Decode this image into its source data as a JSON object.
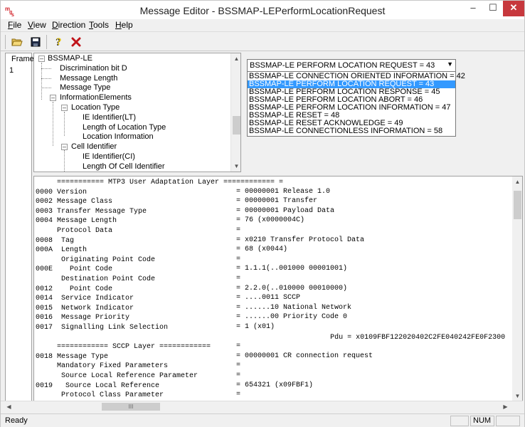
{
  "window": {
    "title": "Message Editor - BSSMAP-LEPerformLocationRequest",
    "app_icon": "msg-logo-icon",
    "minimize_icon": "minimize-icon",
    "maximize_icon": "maximize-icon",
    "close_icon": "close-icon",
    "min_glyph": "–",
    "max_glyph": "☐",
    "close_glyph": "✕"
  },
  "menu": {
    "items": [
      {
        "first": "F",
        "rest": "ile"
      },
      {
        "first": "V",
        "rest": "iew"
      },
      {
        "first": "D",
        "rest": "irection"
      },
      {
        "first": "T",
        "rest": "ools"
      },
      {
        "first": "H",
        "rest": "elp"
      }
    ]
  },
  "toolbar": {
    "buttons": [
      "open-folder-icon",
      "save-disk-icon",
      "help-question-icon",
      "close-x-icon"
    ]
  },
  "frames": {
    "header": "Frame",
    "items": [
      "1"
    ]
  },
  "tree": {
    "nodes": [
      {
        "label": "BSSMAP-LE",
        "toggle": "–"
      },
      {
        "label": "Discrimination bit D"
      },
      {
        "label": "Message Length"
      },
      {
        "label": "Message Type"
      },
      {
        "label": "InformationElements",
        "toggle": "–"
      },
      {
        "label": "Location Type",
        "toggle": "–"
      },
      {
        "label": "IE Identifier(LT)"
      },
      {
        "label": "Length of Location Type"
      },
      {
        "label": "Location Information"
      },
      {
        "label": "Cell Identifier",
        "toggle": "–"
      },
      {
        "label": "IE Identifier(CI)"
      },
      {
        "label": "Length Of Cell Identifier"
      }
    ]
  },
  "combo": {
    "selected": "BSSMAP-LE PERFORM LOCATION REQUEST = 43",
    "options": [
      "BSSMAP-LE CONNECTION ORIENTED INFORMATION = 42",
      "BSSMAP-LE PERFORM LOCATION REQUEST = 43",
      "BSSMAP-LE PERFORM LOCATION RESPONSE = 45",
      "BSSMAP-LE PERFORM LOCATION ABORT = 46",
      "BSSMAP-LE PERFORM LOCATION INFORMATION = 47",
      "BSSMAP-LE RESET = 48",
      "BSSMAP-LE RESET ACKNOWLEDGE = 49",
      "BSSMAP-LE CONNECTIONLESS INFORMATION = 58"
    ],
    "highlighted_index": 1
  },
  "decode": {
    "lines": [
      {
        "field": "     =========== MTP3 User Adaptation Layer ============ =",
        "value": ""
      },
      {
        "field": "0000 Version",
        "value": "= 00000001 Release 1.0"
      },
      {
        "field": "0002 Message Class",
        "value": "= 00000001 Transfer"
      },
      {
        "field": "0003 Transfer Message Type",
        "value": "= 00000001 Payload Data"
      },
      {
        "field": "0004 Message Length",
        "value": "= 76 (x0000004C)"
      },
      {
        "field": "     Protocol Data",
        "value": "="
      },
      {
        "field": "0008  Tag",
        "value": "= x0210 Transfer Protocol Data"
      },
      {
        "field": "000A  Length",
        "value": "= 68 (x0044)"
      },
      {
        "field": "      Originating Point Code",
        "value": "="
      },
      {
        "field": "000E    Point Code",
        "value": "= 1.1.1(..001000 00001001)"
      },
      {
        "field": "      Destination Point Code",
        "value": "="
      },
      {
        "field": "0012    Point Code",
        "value": "= 2.2.0(..010000 00010000)"
      },
      {
        "field": "0014  Service Indicator",
        "value": "= ....0011 SCCP"
      },
      {
        "field": "0015  Network Indicator",
        "value": "= ......10 National Network"
      },
      {
        "field": "0016  Message Priority",
        "value": "= ......00 Priority Code 0"
      },
      {
        "field": "0017  Signalling Link Selection",
        "value": "= 1 (x01)"
      },
      {
        "field": "                                                                     Pdu = x0109FBF122020402C2FE040242FE0F2300",
        "value": ""
      },
      {
        "field": "     ============ SCCP Layer ============",
        "value": "="
      },
      {
        "field": "0018 Message Type",
        "value": "= 00000001 CR connection request"
      },
      {
        "field": "     Mandatory Fixed Parameters",
        "value": "="
      },
      {
        "field": "      Source Local Reference Parameter",
        "value": "="
      },
      {
        "field": "0019   Source Local Reference",
        "value": "= 654321 (x09FBF1)"
      },
      {
        "field": "      Protocol Class Parameter",
        "value": "="
      }
    ]
  },
  "scrollbar": {
    "thumb_grip": "III"
  },
  "status": {
    "text": "Ready",
    "num": "NUM"
  }
}
